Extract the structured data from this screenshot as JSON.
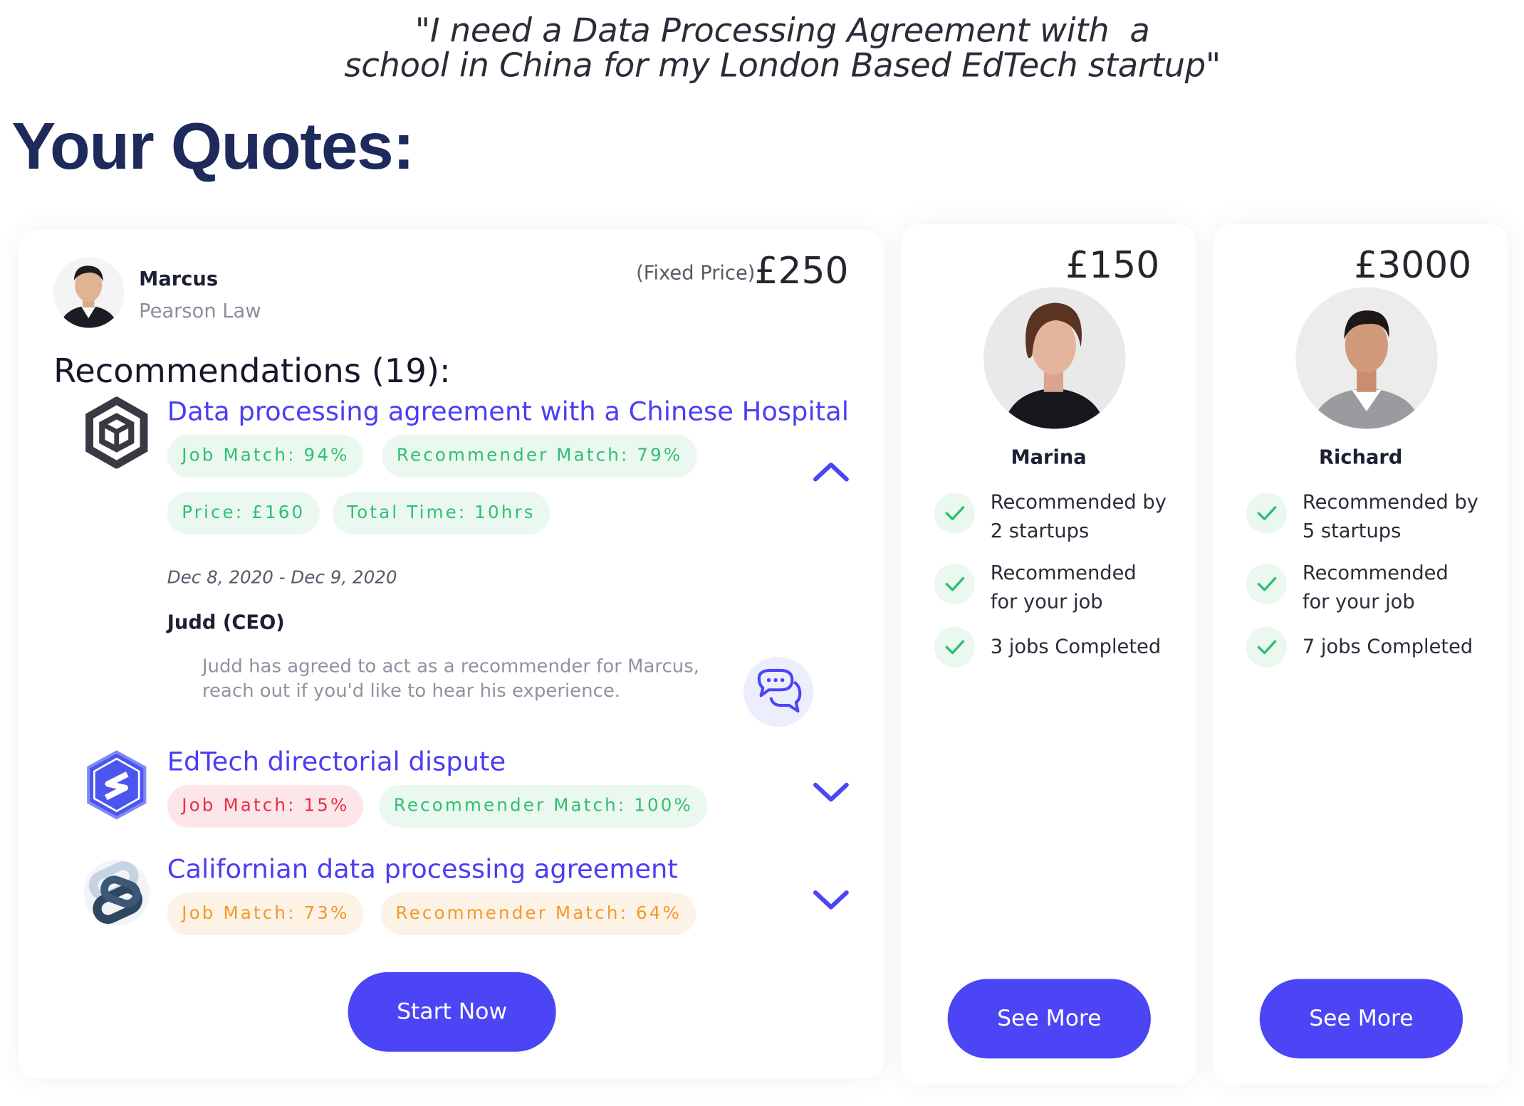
{
  "query": {
    "line1": "\"I need a Data Processing Agreement with  a",
    "line2": "school in China for my London Based EdTech startup\""
  },
  "page_title": "Your Quotes:",
  "main_quote": {
    "name": "Marcus",
    "firm": "Pearson Law",
    "price_label": "(Fixed Price)",
    "price": "£250",
    "recommendations_heading": "Recommendations (19):",
    "recommendations": [
      {
        "title": "Data processing agreement with a Chinese Hospital",
        "logo_icon": "cube-hexagon-icon",
        "expanded": true,
        "job_match": "Job Match: 94%",
        "recommender_match": "Recommender Match: 79%",
        "price": "Price: £160",
        "total_time": "Total Time: 10hrs",
        "date_range": "Dec 8, 2020 - Dec 9, 2020",
        "recommender": "Judd (CEO)",
        "note": "Judd has agreed to act as a recommender for Marcus, reach out if you'd like to hear his experience."
      },
      {
        "title": "EdTech directorial dispute",
        "logo_icon": "s-hexagon-icon",
        "expanded": false,
        "job_match": "Job Match: 15%",
        "recommender_match": "Recommender Match: 100%"
      },
      {
        "title": "Californian data processing agreement",
        "logo_icon": "chain-link-icon",
        "expanded": false,
        "job_match": "Job Match: 73%",
        "recommender_match": "Recommender Match: 64%"
      }
    ],
    "cta": "Start Now"
  },
  "side_quotes": [
    {
      "price": "£150",
      "name": "Marina",
      "features": [
        {
          "line1": "Recommended by",
          "line2": "2 startups"
        },
        {
          "line1": "Recommended",
          "line2": "for your job"
        },
        {
          "line1": "3 jobs Completed",
          "line2": ""
        }
      ],
      "cta": "See More"
    },
    {
      "price": "£3000",
      "name": "Richard",
      "features": [
        {
          "line1": "Recommended by",
          "line2": "5 startups"
        },
        {
          "line1": "Recommended",
          "line2": "for your job"
        },
        {
          "line1": "7 jobs Completed",
          "line2": ""
        }
      ],
      "cta": "See More"
    }
  ],
  "colors": {
    "accent": "#4b45f5",
    "title": "#1d2a5b",
    "match_green": "#2fbf73",
    "match_red": "#e53043",
    "match_orange": "#f29a27"
  }
}
